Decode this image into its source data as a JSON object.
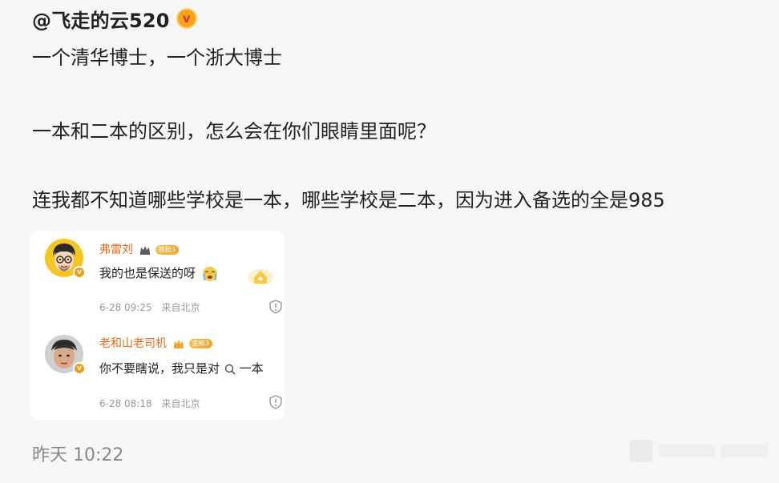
{
  "post": {
    "username": "@飞走的云520",
    "verified_badge_text": "v",
    "lines": [
      "一个清华博士，一个浙大博士",
      "一本和二本的区别，怎么会在你们眼睛里面呢？",
      "连我都不知道哪些学校是一本，哪些学校是二本，因为进入备选的全是985"
    ],
    "timestamp": "昨天 10:22"
  },
  "comments": [
    {
      "name": "弗雷刘",
      "fan_badge": "铁粉3",
      "text": "我的也是保送的呀",
      "date": "6-28 09:25",
      "location": "来自北京"
    },
    {
      "name": "老和山老司机",
      "fan_badge": "金粉3",
      "text": "你不要瞎说，我只是对",
      "link_text": "一本",
      "date": "6-28 08:18",
      "location": "来自北京"
    }
  ],
  "colors": {
    "background": "#f6f6f6",
    "username_accent": "#e86a14",
    "verified": "#f7a21b",
    "meta": "#999999"
  }
}
